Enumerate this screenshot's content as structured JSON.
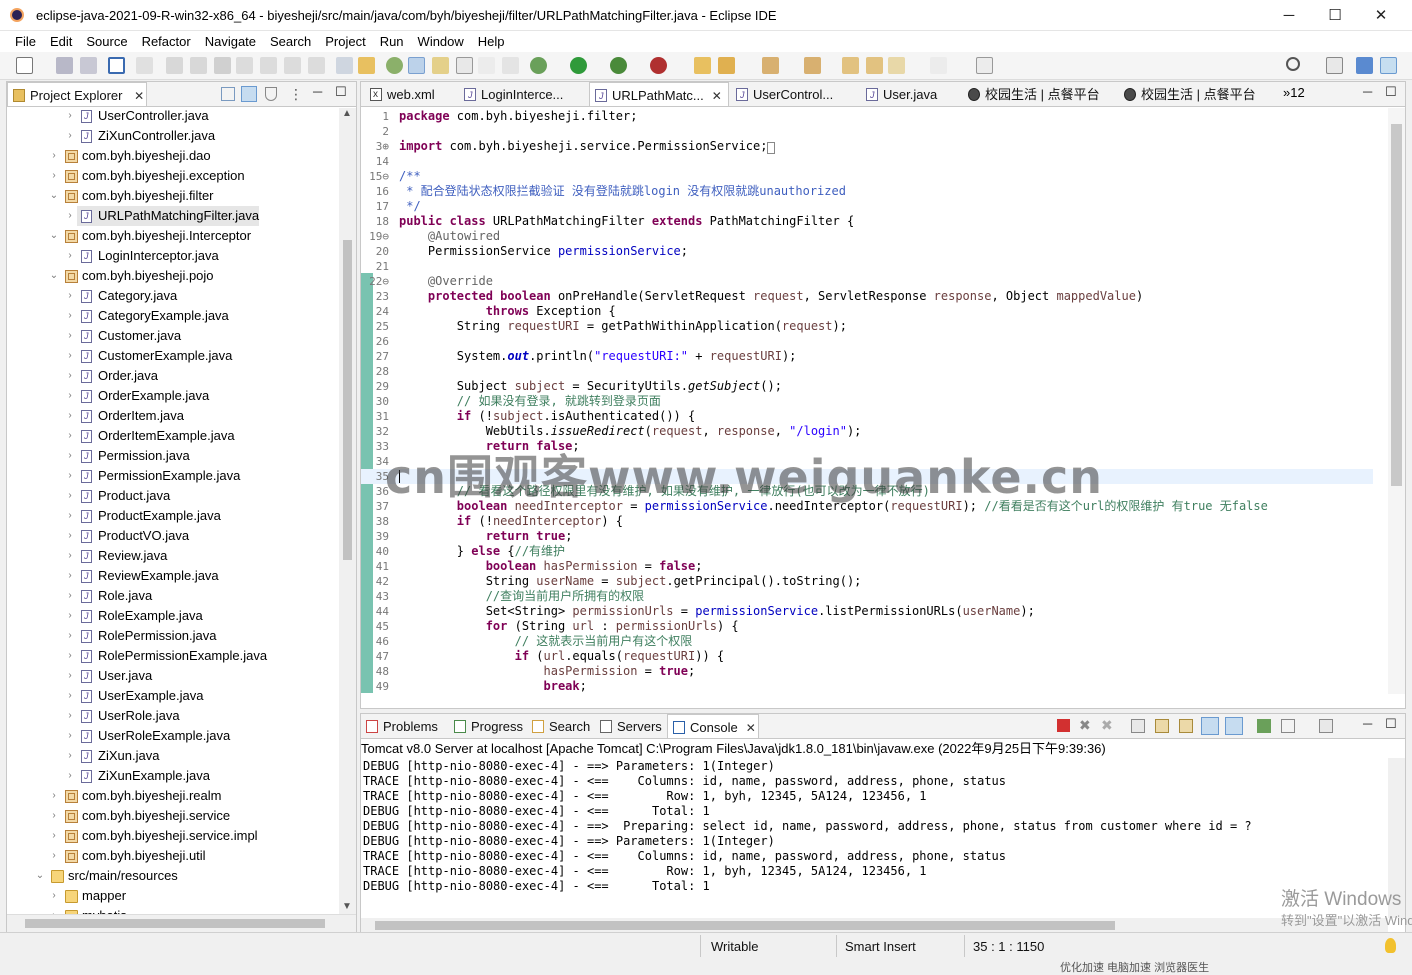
{
  "window": {
    "title": "eclipse-java-2021-09-R-win32-x86_64 - biyesheji/src/main/java/com/byh/biyesheji/filter/URLPathMatchingFilter.java - Eclipse IDE",
    "minimize": "─",
    "maximize": "☐",
    "close": "✕"
  },
  "menu": [
    "File",
    "Edit",
    "Source",
    "Refactor",
    "Navigate",
    "Search",
    "Project",
    "Run",
    "Window",
    "Help"
  ],
  "explorer": {
    "title": "Project Explorer",
    "close": "✕",
    "items": [
      {
        "label": "UserController.java",
        "type": "java",
        "depth": 2
      },
      {
        "label": "ZiXunController.java",
        "type": "java",
        "depth": 2
      },
      {
        "label": "com.byh.biyesheji.dao",
        "type": "pkg",
        "depth": 1,
        "tw": "›"
      },
      {
        "label": "com.byh.biyesheji.exception",
        "type": "pkg",
        "depth": 1,
        "tw": "›"
      },
      {
        "label": "com.byh.biyesheji.filter",
        "type": "pkg",
        "depth": 1,
        "tw": "⌄"
      },
      {
        "label": "URLPathMatchingFilter.java",
        "type": "java",
        "depth": 2,
        "sel": true
      },
      {
        "label": "com.byh.biyesheji.Interceptor",
        "type": "pkg",
        "depth": 1,
        "tw": "⌄"
      },
      {
        "label": "LoginInterceptor.java",
        "type": "java",
        "depth": 2
      },
      {
        "label": "com.byh.biyesheji.pojo",
        "type": "pkg",
        "depth": 1,
        "tw": "⌄"
      },
      {
        "label": "Category.java",
        "type": "java",
        "depth": 2
      },
      {
        "label": "CategoryExample.java",
        "type": "java",
        "depth": 2
      },
      {
        "label": "Customer.java",
        "type": "java",
        "depth": 2
      },
      {
        "label": "CustomerExample.java",
        "type": "java",
        "depth": 2
      },
      {
        "label": "Order.java",
        "type": "java",
        "depth": 2
      },
      {
        "label": "OrderExample.java",
        "type": "java",
        "depth": 2
      },
      {
        "label": "OrderItem.java",
        "type": "java",
        "depth": 2
      },
      {
        "label": "OrderItemExample.java",
        "type": "java",
        "depth": 2
      },
      {
        "label": "Permission.java",
        "type": "java",
        "depth": 2
      },
      {
        "label": "PermissionExample.java",
        "type": "java",
        "depth": 2
      },
      {
        "label": "Product.java",
        "type": "java",
        "depth": 2
      },
      {
        "label": "ProductExample.java",
        "type": "java",
        "depth": 2
      },
      {
        "label": "ProductVO.java",
        "type": "java",
        "depth": 2
      },
      {
        "label": "Review.java",
        "type": "java",
        "depth": 2
      },
      {
        "label": "ReviewExample.java",
        "type": "java",
        "depth": 2
      },
      {
        "label": "Role.java",
        "type": "java",
        "depth": 2
      },
      {
        "label": "RoleExample.java",
        "type": "java",
        "depth": 2
      },
      {
        "label": "RolePermission.java",
        "type": "java",
        "depth": 2
      },
      {
        "label": "RolePermissionExample.java",
        "type": "java",
        "depth": 2
      },
      {
        "label": "User.java",
        "type": "java",
        "depth": 2
      },
      {
        "label": "UserExample.java",
        "type": "java",
        "depth": 2
      },
      {
        "label": "UserRole.java",
        "type": "java",
        "depth": 2
      },
      {
        "label": "UserRoleExample.java",
        "type": "java",
        "depth": 2
      },
      {
        "label": "ZiXun.java",
        "type": "java",
        "depth": 2
      },
      {
        "label": "ZiXunExample.java",
        "type": "java",
        "depth": 2
      },
      {
        "label": "com.byh.biyesheji.realm",
        "type": "pkg",
        "depth": 1,
        "tw": "›"
      },
      {
        "label": "com.byh.biyesheji.service",
        "type": "pkg",
        "depth": 1,
        "tw": "›"
      },
      {
        "label": "com.byh.biyesheji.service.impl",
        "type": "pkg",
        "depth": 1,
        "tw": "›"
      },
      {
        "label": "com.byh.biyesheji.util",
        "type": "pkg",
        "depth": 1,
        "tw": "›"
      },
      {
        "label": "src/main/resources",
        "type": "src",
        "depth": 0,
        "tw": "⌄"
      },
      {
        "label": "mapper",
        "type": "folder",
        "depth": 1,
        "tw": "›"
      },
      {
        "label": "mybatis",
        "type": "folder",
        "depth": 1,
        "tw": "›"
      }
    ]
  },
  "editor_tabs": [
    {
      "label": "web.xml",
      "icon": "xml"
    },
    {
      "label": "LoginInterce...",
      "icon": "java"
    },
    {
      "label": "URLPathMatc...",
      "icon": "java",
      "active": true,
      "close": "✕"
    },
    {
      "label": "UserControl...",
      "icon": "java"
    },
    {
      "label": "User.java",
      "icon": "java"
    },
    {
      "label": "校园生活 | 点餐平台",
      "icon": "web"
    },
    {
      "label": "校园生活 | 点餐平台",
      "icon": "web"
    }
  ],
  "editor_overflow": "»12",
  "code": [
    {
      "n": "1",
      "h": "<span class='kw'>package</span> com.byh.biyesheji.filter;"
    },
    {
      "n": "2",
      "h": ""
    },
    {
      "n": "3⊕",
      "h": "<span class='kw'>import</span> com.byh.biyesheji.service.PermissionService;<span style='border:1px solid #888;font-size:9px'>&nbsp;</span>"
    },
    {
      "n": "14",
      "h": ""
    },
    {
      "n": "15⊖",
      "h": "<span class='cm'>/**</span>"
    },
    {
      "n": "16",
      "h": "<span class='cm'> * 配合登陆状态权限拦截验证 没有登陆就跳login 没有权限就跳unauthorized</span>"
    },
    {
      "n": "17",
      "h": "<span class='cm'> */</span>"
    },
    {
      "n": "18",
      "h": "<span class='kw'>public class</span> URLPathMatchingFilter <span class='kw'>extends</span> PathMatchingFilter {"
    },
    {
      "n": "19⊖",
      "h": "    <span class='an'>@Autowired</span>"
    },
    {
      "n": "20",
      "h": "    PermissionService <span class='fv'>permissionService</span>;"
    },
    {
      "n": "21",
      "h": ""
    },
    {
      "n": "22⊖",
      "h": "    <span class='an'>@Override</span>"
    },
    {
      "n": "23",
      "h": "    <span class='kw'>protected boolean</span> onPreHandle(ServletRequest <span class='lv'>request</span>, ServletResponse <span class='lv'>response</span>, Object <span class='lv'>mappedValue</span>)"
    },
    {
      "n": "24",
      "h": "            <span class='kw'>throws</span> Exception {"
    },
    {
      "n": "25",
      "h": "        String <span class='lv'>requestURI</span> = getPathWithinApplication(<span class='lv'>request</span>);"
    },
    {
      "n": "26",
      "h": ""
    },
    {
      "n": "27",
      "h": "        System.<span class='fv it' style='font-weight:bold'>out</span>.println(<span class='st'>\"requestURI:\"</span> + <span class='lv'>requestURI</span>);"
    },
    {
      "n": "28",
      "h": ""
    },
    {
      "n": "29",
      "h": "        Subject <span class='lv'>subject</span> = SecurityUtils.<span class='it'>getSubject</span>();"
    },
    {
      "n": "30",
      "h": "        <span class='lc'>// 如果没有登录, 就跳转到登录页面</span>"
    },
    {
      "n": "31",
      "h": "        <span class='kw'>if</span> (!<span class='lv'>subject</span>.isAuthenticated()) {"
    },
    {
      "n": "32",
      "h": "            WebUtils.<span class='it'>issueRedirect</span>(<span class='lv'>request</span>, <span class='lv'>response</span>, <span class='st'>\"/login\"</span>);"
    },
    {
      "n": "33",
      "h": "            <span class='kw'>return false</span>;"
    },
    {
      "n": "34",
      "h": ""
    },
    {
      "n": "35",
      "h": "",
      "cur": true
    },
    {
      "n": "36",
      "h": "        <span class='lc'>// 看看这个路径权限里有没有维护, 如果没有维护, 一律放行(也可以改为一律不放行)</span>"
    },
    {
      "n": "37",
      "h": "        <span class='kw'>boolean</span> <span class='lv'>needInterceptor</span> = <span class='fv'>permissionService</span>.needInterceptor(<span class='lv'>requestURI</span>); <span class='lc'>//看看是否有这个url的权限维护 有true 无false</span>"
    },
    {
      "n": "38",
      "h": "        <span class='kw'>if</span> (!<span class='lv'>needInterceptor</span>) {"
    },
    {
      "n": "39",
      "h": "            <span class='kw'>return true</span>;"
    },
    {
      "n": "40",
      "h": "        } <span class='kw'>else</span> {<span class='lc'>//有维护</span>"
    },
    {
      "n": "41",
      "h": "            <span class='kw'>boolean</span> <span class='lv'>hasPermission</span> = <span class='kw'>false</span>;"
    },
    {
      "n": "42",
      "h": "            String <span class='lv'>userName</span> = <span class='lv'>subject</span>.getPrincipal().toString();"
    },
    {
      "n": "43",
      "h": "            <span class='lc'>//查询当前用户所拥有的权限</span>"
    },
    {
      "n": "44",
      "h": "            Set&lt;String&gt; <span class='lv'>permissionUrls</span> = <span class='fv'>permissionService</span>.listPermissionURLs(<span class='lv'>userName</span>);"
    },
    {
      "n": "45",
      "h": "            <span class='kw'>for</span> (String <span class='lv'>url</span> : <span class='lv'>permissionUrls</span>) {"
    },
    {
      "n": "46",
      "h": "                <span class='lc'>// 这就表示当前用户有这个权限</span>"
    },
    {
      "n": "47",
      "h": "                <span class='kw'>if</span> (<span class='lv'>url</span>.equals(<span class='lv'>requestURI</span>)) {"
    },
    {
      "n": "48",
      "h": "                    <span class='lv'>hasPermission</span> = <span class='kw'>true</span>;"
    },
    {
      "n": "49",
      "h": "                    <span class='kw'>break</span>;"
    }
  ],
  "bottom_tabs": [
    {
      "label": "Problems",
      "icon": "problems"
    },
    {
      "label": "Progress",
      "icon": "progress"
    },
    {
      "label": "Search",
      "icon": "search"
    },
    {
      "label": "Servers",
      "icon": "servers"
    },
    {
      "label": "Console",
      "icon": "console",
      "active": true,
      "close": "✕"
    }
  ],
  "console": {
    "header": "Tomcat v8.0 Server at localhost [Apache Tomcat] C:\\Program Files\\Java\\jdk1.8.0_181\\bin\\javaw.exe  (2022年9月25日下午9:39:36)",
    "lines": [
      "DEBUG [http-nio-8080-exec-4] - ==> Parameters: 1(Integer)",
      "TRACE [http-nio-8080-exec-4] - <==    Columns: id, name, password, address, phone, status",
      "TRACE [http-nio-8080-exec-4] - <==        Row: 1, byh, 12345, 5A124, 123456, 1",
      "DEBUG [http-nio-8080-exec-4] - <==      Total: 1",
      "DEBUG [http-nio-8080-exec-4] - ==>  Preparing: select id, name, password, address, phone, status from customer where id = ?",
      "DEBUG [http-nio-8080-exec-4] - ==> Parameters: 1(Integer)",
      "TRACE [http-nio-8080-exec-4] - <==    Columns: id, name, password, address, phone, status",
      "TRACE [http-nio-8080-exec-4] - <==        Row: 1, byh, 12345, 5A124, 123456, 1",
      "DEBUG [http-nio-8080-exec-4] - <==      Total: 1"
    ]
  },
  "status": {
    "writable": "Writable",
    "insert": "Smart Insert",
    "position": "35 : 1 : 1150"
  },
  "watermark": "cn围观客www.weiguanke.cn",
  "activation": {
    "line1": "激活 Windows",
    "line2": "转到\"设置\"以激活 Windows。"
  },
  "taskbar_hint": "优化加速   电脑加速   浏览器医生"
}
